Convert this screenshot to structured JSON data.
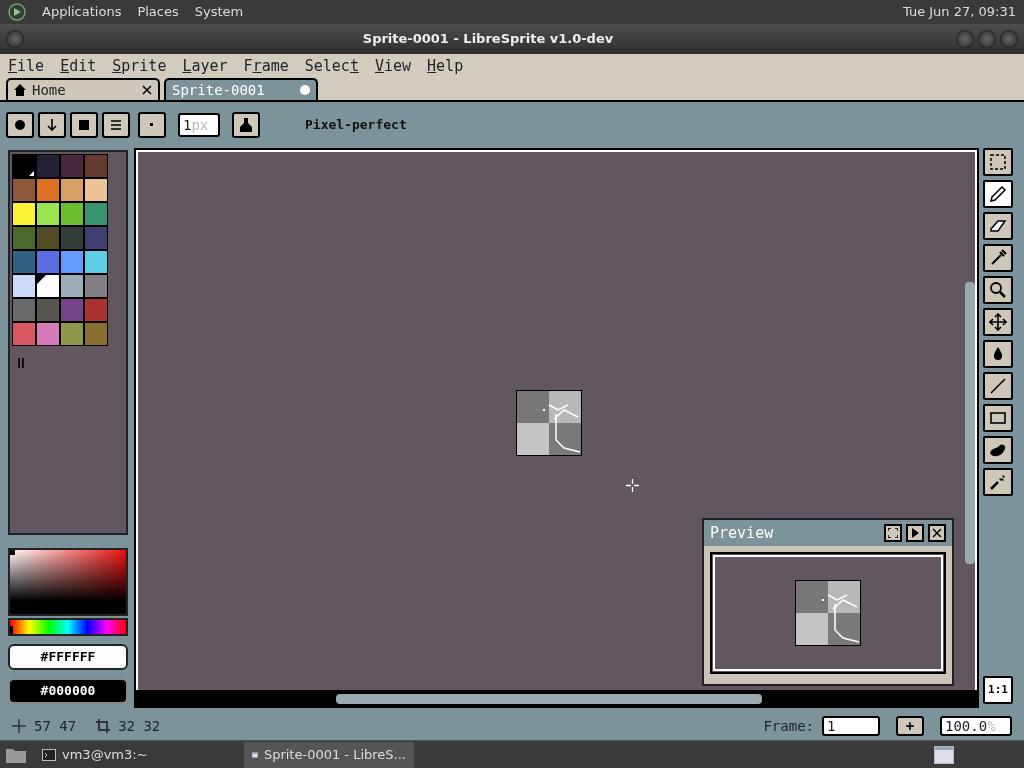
{
  "top_panel": {
    "menus": [
      "Applications",
      "Places",
      "System"
    ],
    "clock": "Tue Jun 27, 09:31"
  },
  "window": {
    "title": "Sprite-0001 - LibreSprite v1.0-dev"
  },
  "menu": [
    "File",
    "Edit",
    "Sprite",
    "Layer",
    "Frame",
    "Select",
    "View",
    "Help"
  ],
  "tabs": [
    {
      "label": "Home",
      "kind": "home",
      "selected": false,
      "modified": false
    },
    {
      "label": "Sprite-0001",
      "kind": "document",
      "selected": true,
      "modified": true
    }
  ],
  "toolbar": {
    "brush_size": {
      "value": "1",
      "unit": "px"
    },
    "pixel_perfect": {
      "label": "Pixel-perfect",
      "checked": false
    }
  },
  "palette": [
    {
      "color": "#000000",
      "kind": "background"
    },
    {
      "color": "#222034"
    },
    {
      "color": "#45283c"
    },
    {
      "color": "#663931"
    },
    {
      "color": "#8f563b"
    },
    {
      "color": "#df7126"
    },
    {
      "color": "#d9a066"
    },
    {
      "color": "#eec39a"
    },
    {
      "color": "#fbf236"
    },
    {
      "color": "#99e550"
    },
    {
      "color": "#6abe30"
    },
    {
      "color": "#37946e"
    },
    {
      "color": "#4b692f"
    },
    {
      "color": "#524b24"
    },
    {
      "color": "#323c39"
    },
    {
      "color": "#3f3f74"
    },
    {
      "color": "#306082"
    },
    {
      "color": "#5b6ee1"
    },
    {
      "color": "#639bff"
    },
    {
      "color": "#5fcde4"
    },
    {
      "color": "#cbdbfc"
    },
    {
      "color": "#ffffff",
      "kind": "foreground"
    },
    {
      "color": "#9badb7"
    },
    {
      "color": "#847e87"
    },
    {
      "color": "#696a6a"
    },
    {
      "color": "#595652"
    },
    {
      "color": "#76428a"
    },
    {
      "color": "#ac3232"
    },
    {
      "color": "#d95763"
    },
    {
      "color": "#d77bba"
    },
    {
      "color": "#8f974a"
    },
    {
      "color": "#8a6f30"
    }
  ],
  "colors": {
    "foreground": "#FFFFFF",
    "background": "#000000",
    "hue": {
      "level": 0
    }
  },
  "tools": [
    {
      "kind": "marquee",
      "selected": false
    },
    {
      "kind": "pencil",
      "selected": true
    },
    {
      "kind": "eraser",
      "selected": false
    },
    {
      "kind": "eyedropper",
      "selected": false
    },
    {
      "kind": "zoom",
      "selected": false
    },
    {
      "kind": "move",
      "selected": false
    },
    {
      "kind": "fill",
      "selected": false
    },
    {
      "kind": "line",
      "selected": false
    },
    {
      "kind": "rectangle",
      "selected": false
    },
    {
      "kind": "contour",
      "selected": false
    },
    {
      "kind": "spray",
      "selected": false
    }
  ],
  "zoom_reset": "1:1",
  "preview": {
    "title": "Preview"
  },
  "status": {
    "position": "57 47",
    "size": "32 32",
    "frame_label": "Frame:",
    "frame": "1",
    "add": "+",
    "zoom": {
      "value": "100.0",
      "unit": "%"
    }
  },
  "taskbar": [
    {
      "label": "vm3@vm3:~",
      "selected": false
    },
    {
      "label": "Sprite-0001 - LibreS...",
      "selected": true
    }
  ]
}
